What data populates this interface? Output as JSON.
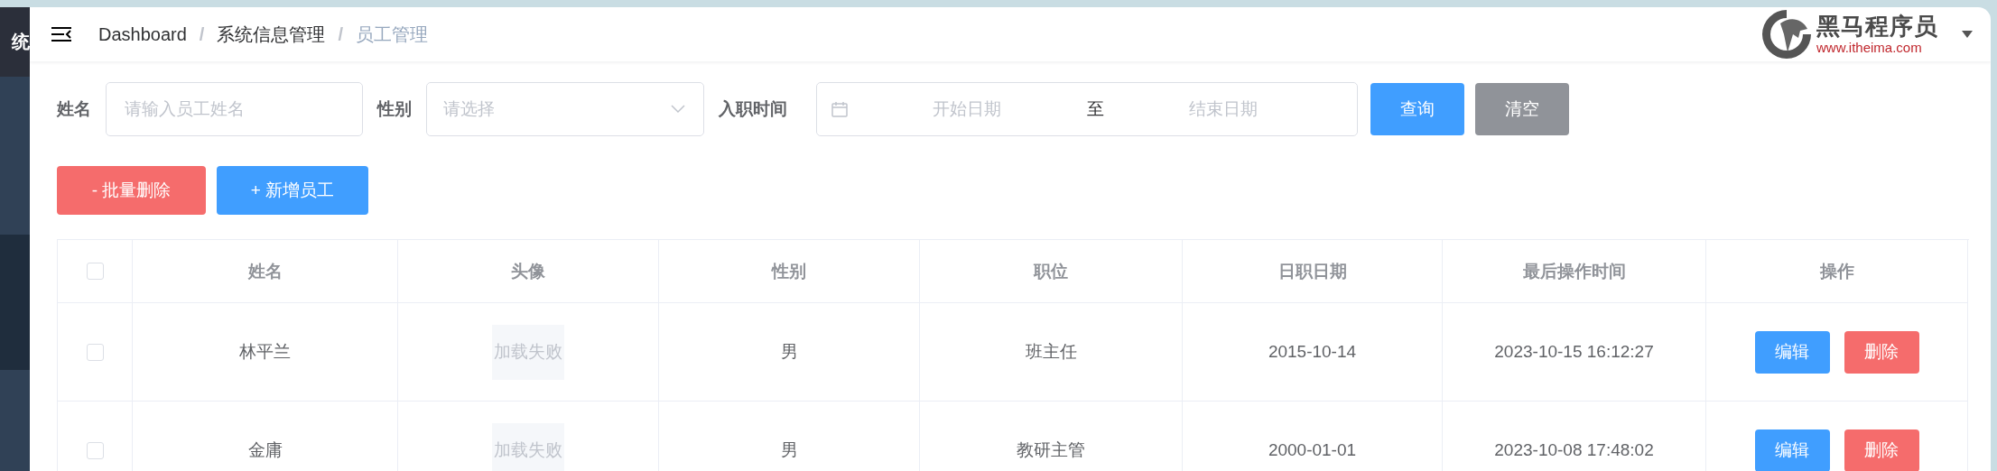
{
  "sidebar": {
    "title": "统"
  },
  "header": {
    "breadcrumb": [
      {
        "label": "Dashboard",
        "current": false
      },
      {
        "label": "系统信息管理",
        "current": false
      },
      {
        "label": "员工管理",
        "current": true
      }
    ],
    "separator": "/",
    "logo": {
      "name": "黑马程序员",
      "url": "www.itheima.com"
    }
  },
  "filters": {
    "name": {
      "label": "姓名",
      "placeholder": "请输入员工姓名"
    },
    "gender": {
      "label": "性别",
      "placeholder": "请选择"
    },
    "entry_date": {
      "label": "入职时间",
      "start_placeholder": "开始日期",
      "separator": "至",
      "end_placeholder": "结束日期"
    },
    "buttons": [
      {
        "label": "查询",
        "kind": "primary"
      },
      {
        "label": "清空",
        "kind": "info"
      }
    ]
  },
  "actions": [
    {
      "label": "- 批量删除",
      "kind": "danger"
    },
    {
      "label": "+ 新增员工",
      "kind": "primary"
    }
  ],
  "table": {
    "header_checked": false,
    "columns": [
      "姓名",
      "头像",
      "性别",
      "职位",
      "日职日期",
      "最后操作时间",
      "操作"
    ],
    "rows": [
      {
        "checked": false,
        "name": "林平兰",
        "avatar": "加载失败",
        "gender": "男",
        "position": "班主任",
        "entry_date": "2015-10-14",
        "updated": "2023-10-15 16:12:27",
        "actions": [
          "编辑",
          "删除"
        ]
      },
      {
        "checked": false,
        "name": "金庸",
        "avatar": "加载失败",
        "gender": "男",
        "position": "教研主管",
        "entry_date": "2000-01-01",
        "updated": "2023-10-08 17:48:02",
        "actions": [
          "编辑",
          "删除"
        ]
      }
    ]
  }
}
